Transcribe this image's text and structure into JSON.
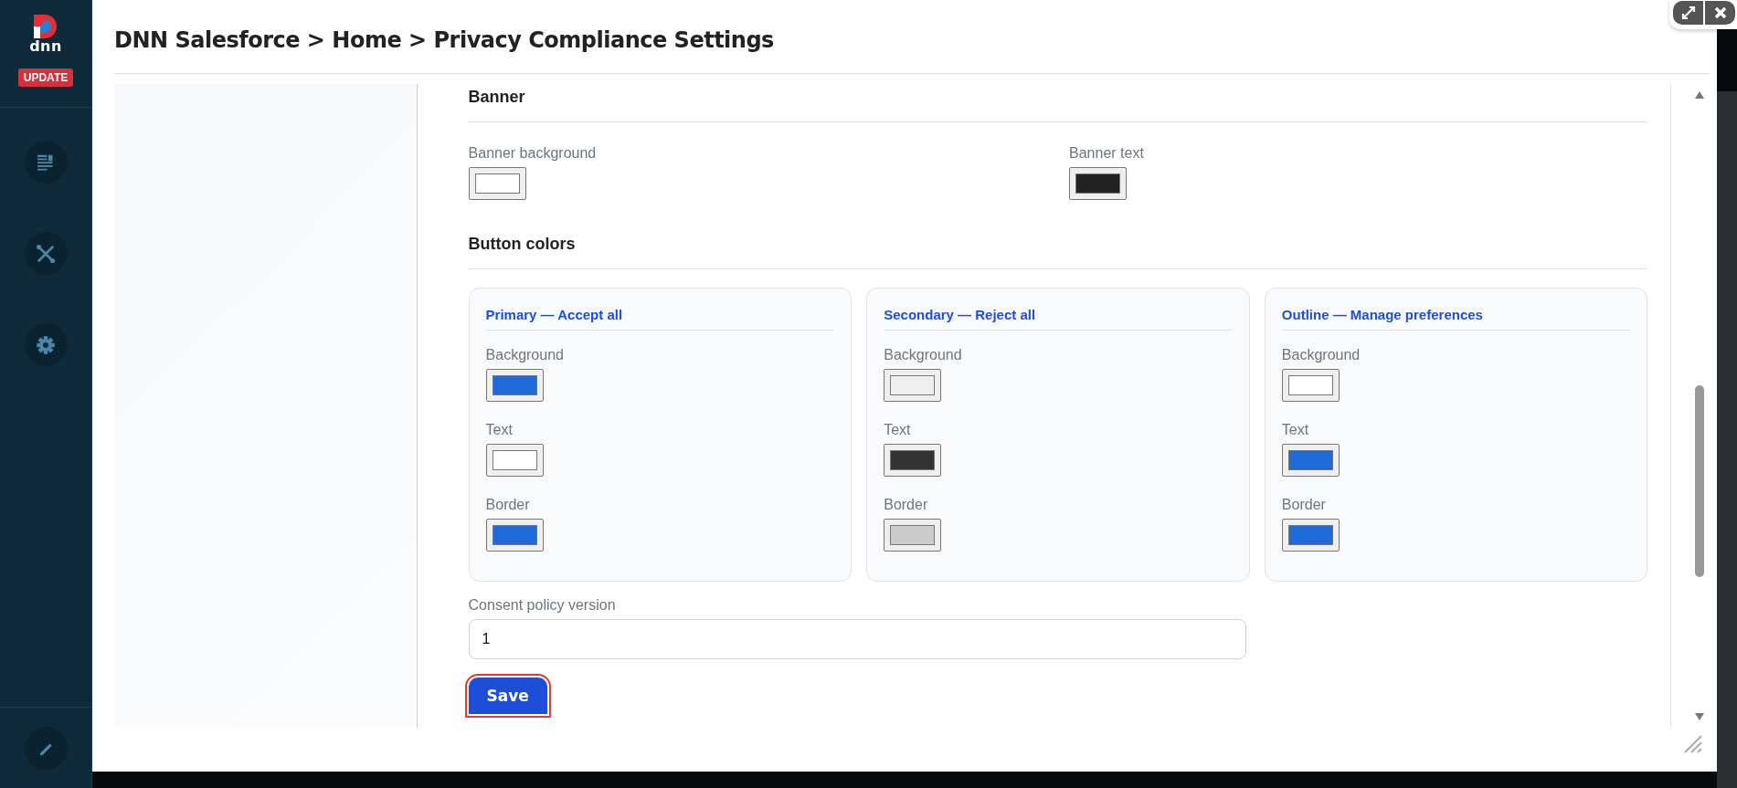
{
  "sidebar": {
    "logo_text": "dnn",
    "update_badge": "UPDATE",
    "items": [
      {
        "kind": "pages"
      },
      {
        "kind": "tools"
      },
      {
        "kind": "settings"
      }
    ],
    "footer_item": {
      "kind": "edit"
    }
  },
  "window": {
    "title": "DNN Salesforce > Home > Privacy Compliance Settings"
  },
  "banner": {
    "heading": "Banner",
    "fields": [
      {
        "label": "Banner background",
        "color": "#ffffff"
      },
      {
        "label": "Banner text",
        "color": "#222222"
      }
    ]
  },
  "button_colors": {
    "heading": "Button colors",
    "cards": [
      {
        "title": "Primary — Accept all",
        "fields": [
          {
            "label": "Background",
            "color": "#1e6ad8"
          },
          {
            "label": "Text",
            "color": "#ffffff"
          },
          {
            "label": "Border",
            "color": "#1e6ad8"
          }
        ]
      },
      {
        "title": "Secondary — Reject all",
        "fields": [
          {
            "label": "Background",
            "color": "#f0f0f0"
          },
          {
            "label": "Text",
            "color": "#333333"
          },
          {
            "label": "Border",
            "color": "#cccccc"
          }
        ]
      },
      {
        "title": "Outline — Manage preferences",
        "fields": [
          {
            "label": "Background",
            "color": "#ffffff"
          },
          {
            "label": "Text",
            "color": "#1e6ad8"
          },
          {
            "label": "Border",
            "color": "#1e6ad8"
          }
        ]
      }
    ]
  },
  "consent": {
    "label": "Consent policy version",
    "value": "1"
  },
  "save_button": {
    "label": "Save",
    "highlighted": true
  }
}
